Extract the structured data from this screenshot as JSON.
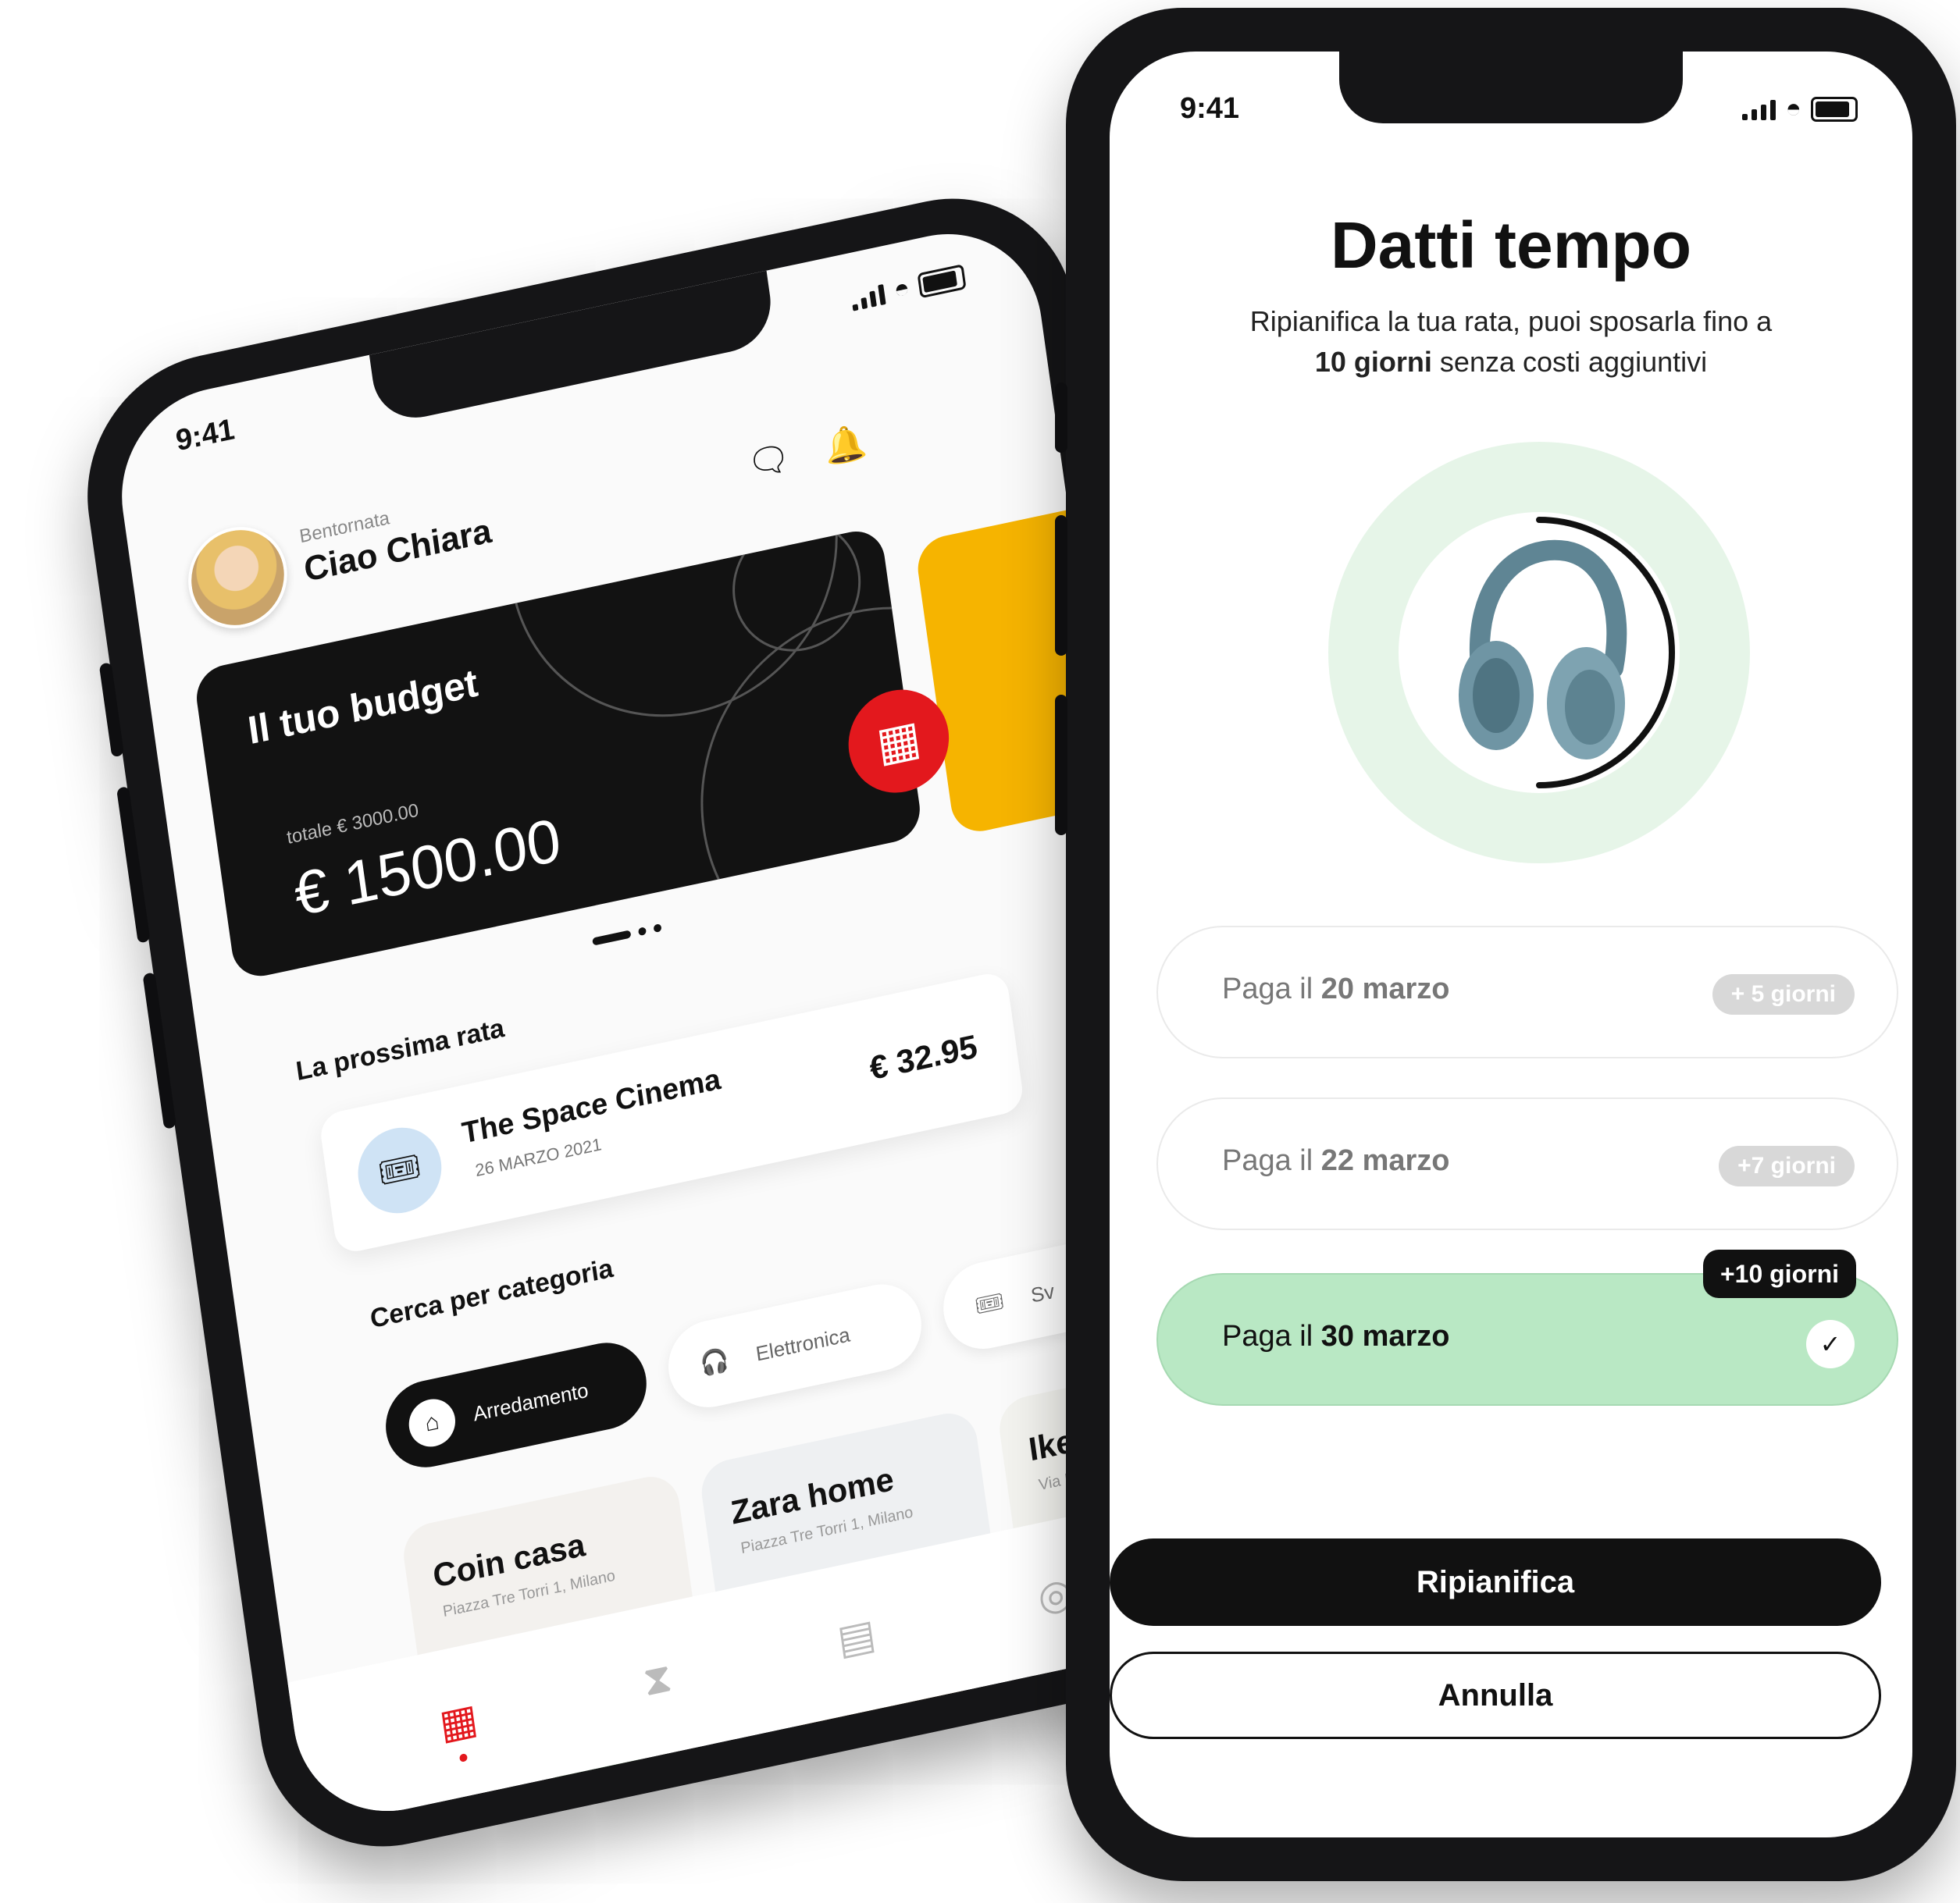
{
  "left_phone": {
    "status": {
      "time": "9:41"
    },
    "header": {
      "greeting_small": "Bentornata",
      "greeting": "Ciao Chiara",
      "icons": [
        "chat-icon",
        "bell-icon"
      ]
    },
    "budget_card": {
      "title": "Il tuo budget",
      "total_label": "totale € 3000.00",
      "amount": "€ 1500.00"
    },
    "next_installment": {
      "section_title": "La prossima rata",
      "merchant": "The Space Cinema",
      "date": "26 MARZO 2021",
      "amount": "€ 32.95"
    },
    "categories": {
      "section_title": "Cerca per categoria",
      "chips": [
        {
          "label": "Arredamento",
          "icon": "lamp-icon",
          "active": true
        },
        {
          "label": "Elettronica",
          "icon": "headphones-icon",
          "active": false
        },
        {
          "label": "Sv",
          "icon": "ticket-icon",
          "active": false
        }
      ]
    },
    "stores": [
      {
        "name": "Coin casa",
        "address": "Piazza Tre Torri 1, Milano"
      },
      {
        "name": "Zara home",
        "address": "Piazza Tre Torri 1, Milano"
      },
      {
        "name": "Ike",
        "address": "Via M"
      }
    ],
    "tabbar": [
      "home-grid-icon",
      "hourglass-icon",
      "map-icon",
      "profile-icon"
    ]
  },
  "right_phone": {
    "status": {
      "time": "9:41"
    },
    "title": "Datti tempo",
    "subtitle_part1": "Ripianifica la tua rata, puoi sposarla fino a",
    "subtitle_bold": "10 giorni",
    "subtitle_part2": "senza costi aggiuntivi",
    "options": [
      {
        "prefix": "Paga il",
        "date": "20 marzo",
        "badge": "+ 5 giorni",
        "selected": false
      },
      {
        "prefix": "Paga il",
        "date": "22 marzo",
        "badge": "+7 giorni",
        "selected": false
      },
      {
        "prefix": "Paga il",
        "date": "30 marzo",
        "badge": "+10 giorni",
        "selected": true
      }
    ],
    "primary_button": "Ripianifica",
    "secondary_button": "Annulla"
  },
  "colors": {
    "accent_red": "#e3181d",
    "card_yellow": "#f6b400",
    "selected_green": "#b9e8c4",
    "dark": "#111111"
  }
}
